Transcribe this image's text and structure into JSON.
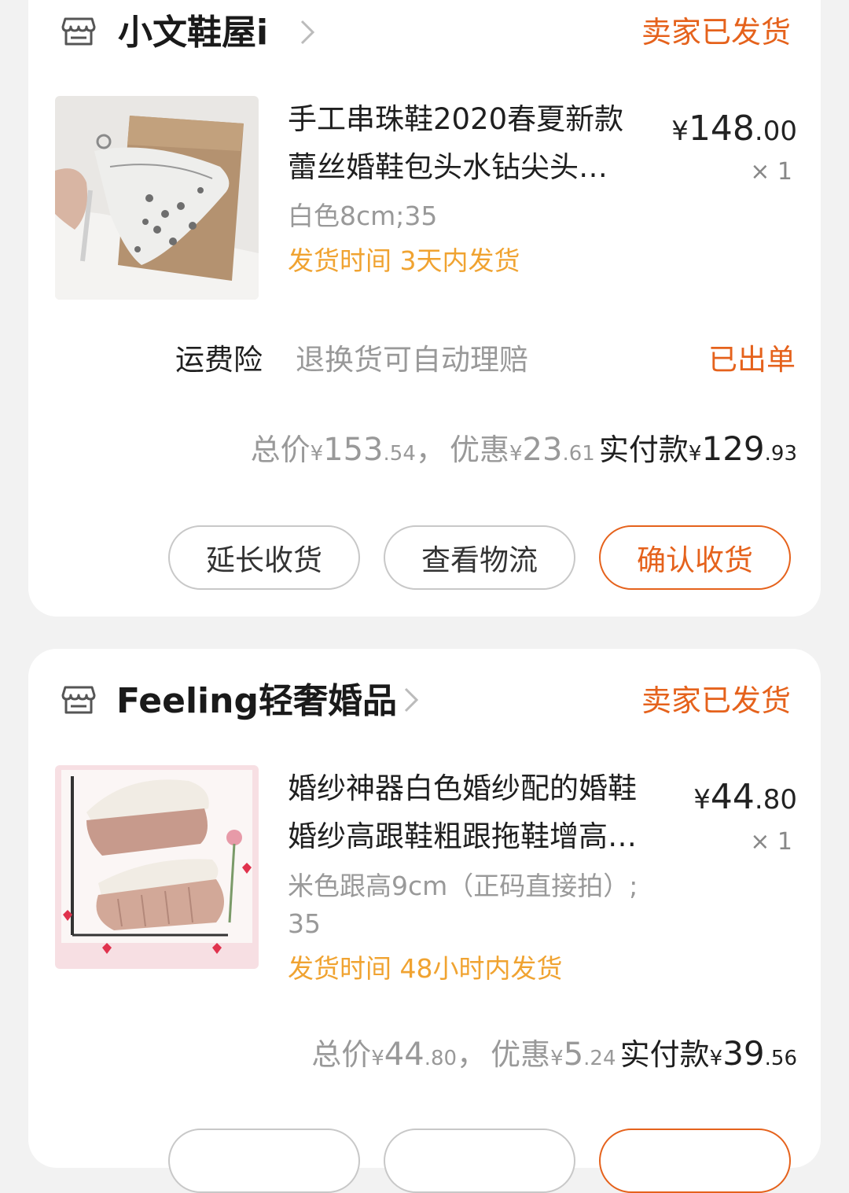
{
  "colors": {
    "accent_orange": "#e5621c",
    "ship_yellow": "#f0a331",
    "muted_gray": "#999999",
    "background": "#f2f2f2"
  },
  "orders": [
    {
      "shop_icon": "store-icon",
      "shop_name": "小文鞋屋i",
      "status": "卖家已发货",
      "item": {
        "thumbnail_icon": "product-image-beaded-heel",
        "title_line1": "手工串珠鞋2020春夏新款",
        "title_line2": "蕾丝婚鞋包头水钻尖头…",
        "price_currency": "¥",
        "price_int": "148",
        "price_dec": ".00",
        "qty": "× 1",
        "sku": "白色8cm;35",
        "ship_label": "发货时间",
        "ship_value": "3天内发货"
      },
      "insurance": {
        "label": "运费险",
        "desc": "退换货可自动理赔",
        "status": "已出单"
      },
      "totals": {
        "total_label": "总价",
        "total_cur": "¥",
        "total_int": "153",
        "total_dec": ".54",
        "sep": "，",
        "discount_label": "优惠",
        "discount_cur": "¥",
        "discount_int": "23",
        "discount_dec": ".61",
        "paid_label": "实付款",
        "paid_cur": "¥",
        "paid_int": "129",
        "paid_dec": ".93"
      },
      "buttons": {
        "extend": "延长收货",
        "logistics": "查看物流",
        "confirm": "确认收货"
      }
    },
    {
      "shop_icon": "store-icon",
      "shop_name": "Feeling轻奢婚品",
      "status": "卖家已发货",
      "item": {
        "thumbnail_icon": "product-image-wedge-slipper",
        "title_line1": "婚纱神器白色婚纱配的婚鞋",
        "title_line2": "婚纱高跟鞋粗跟拖鞋增高…",
        "price_currency": "¥",
        "price_int": "44",
        "price_dec": ".80",
        "qty": "× 1",
        "sku_line1": "米色跟高9cm（正码直接拍）;",
        "sku_line2": "35",
        "ship_label": "发货时间",
        "ship_value": "48小时内发货"
      },
      "totals": {
        "total_label": "总价",
        "total_cur": "¥",
        "total_int": "44",
        "total_dec": ".80",
        "sep": "，",
        "discount_label": "优惠",
        "discount_cur": "¥",
        "discount_int": "5",
        "discount_dec": ".24",
        "paid_label": "实付款",
        "paid_cur": "¥",
        "paid_int": "39",
        "paid_dec": ".56"
      }
    }
  ]
}
